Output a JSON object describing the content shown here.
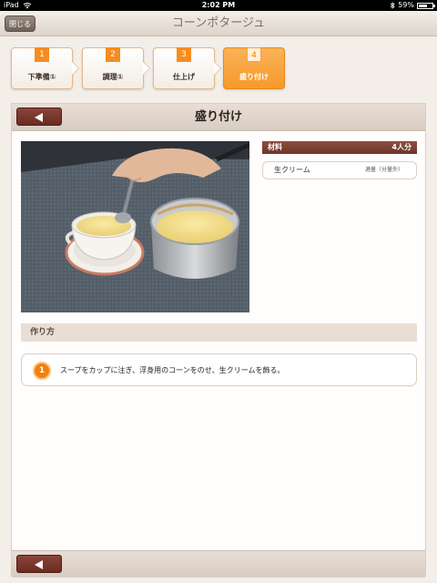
{
  "status": {
    "device": "iPad",
    "time": "2:02 PM",
    "battery": "59%"
  },
  "nav": {
    "close_label": "閉じる",
    "title": "コーンポタージュ"
  },
  "steps": [
    {
      "num": "1",
      "label": "下準備①"
    },
    {
      "num": "2",
      "label": "調理①"
    },
    {
      "num": "3",
      "label": "仕上げ"
    },
    {
      "num": "4",
      "label": "盛り付け"
    }
  ],
  "active_step": 4,
  "panel": {
    "title": "盛り付け"
  },
  "ingredients": {
    "header": "材料",
    "servings": "4人分",
    "items": [
      {
        "name": "生クリーム",
        "amount": "適量（分量外）"
      }
    ]
  },
  "howto": {
    "header": "作り方",
    "steps": [
      {
        "num": "1",
        "text": "スープをカップに注ぎ、浮身用のコーンをのせ、生クリームを飾る。"
      }
    ]
  },
  "colors": {
    "accent": "#f58d1f",
    "brown": "#7a3a2e"
  }
}
